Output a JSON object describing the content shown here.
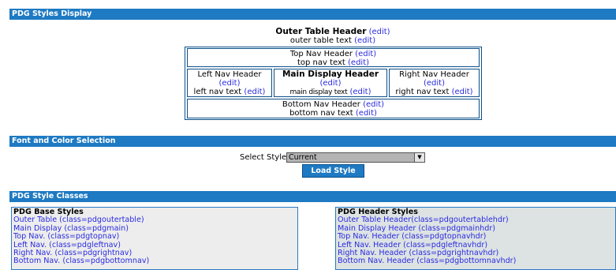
{
  "sections": {
    "display_title": "PDG Styles Display",
    "font_title": "Font and Color Selection",
    "classes_title": "PDG Style Classes"
  },
  "edit_label": "(edit)",
  "outer": {
    "header": "Outer Table Header",
    "text": "outer table text"
  },
  "top": {
    "header": "Top Nav Header",
    "text": "top nav text"
  },
  "left": {
    "header": "Left Nav Header",
    "text": "left nav text"
  },
  "main": {
    "header": "Main Display Header",
    "text": "main display text"
  },
  "right": {
    "header": "Right Nav Header",
    "text": "right nav text"
  },
  "bottom": {
    "header": "Bottom Nav Header",
    "text": "bottom nav text"
  },
  "selection": {
    "label": "Select Style",
    "selected": "Current",
    "load_button": "Load Style"
  },
  "base_styles": {
    "title": "PDG Base Styles",
    "items": [
      "Outer Table (class=pdgoutertable)",
      "Main Display (class=pdgmain)",
      "Top Nav. (class=pdgtopnav)",
      "Left Nav. (class=pdgleftnav)",
      "Right Nav. (class=pdgrightnav)",
      "Bottom Nav. (class=pdgbottomnav)"
    ]
  },
  "header_styles": {
    "title": "PDG Header Styles",
    "items": [
      "Outer Table Header(class=pdgoutertablehdr)",
      "Main Display Header (class=pdgmainhdr)",
      "Top Nav. Header (class=pdgtopnavhdr)",
      "Left Nav. Header (class=pdgleftnavhdr)",
      "Right Nav. Header (class=pdgrightnavhdr)",
      "Bottom Nav. Header (class=pdgbottomnavhdr)"
    ]
  },
  "colors": {
    "section_bar": "#1e7ac2",
    "link": "#2a2ae0",
    "border": "#0b4f8a"
  }
}
